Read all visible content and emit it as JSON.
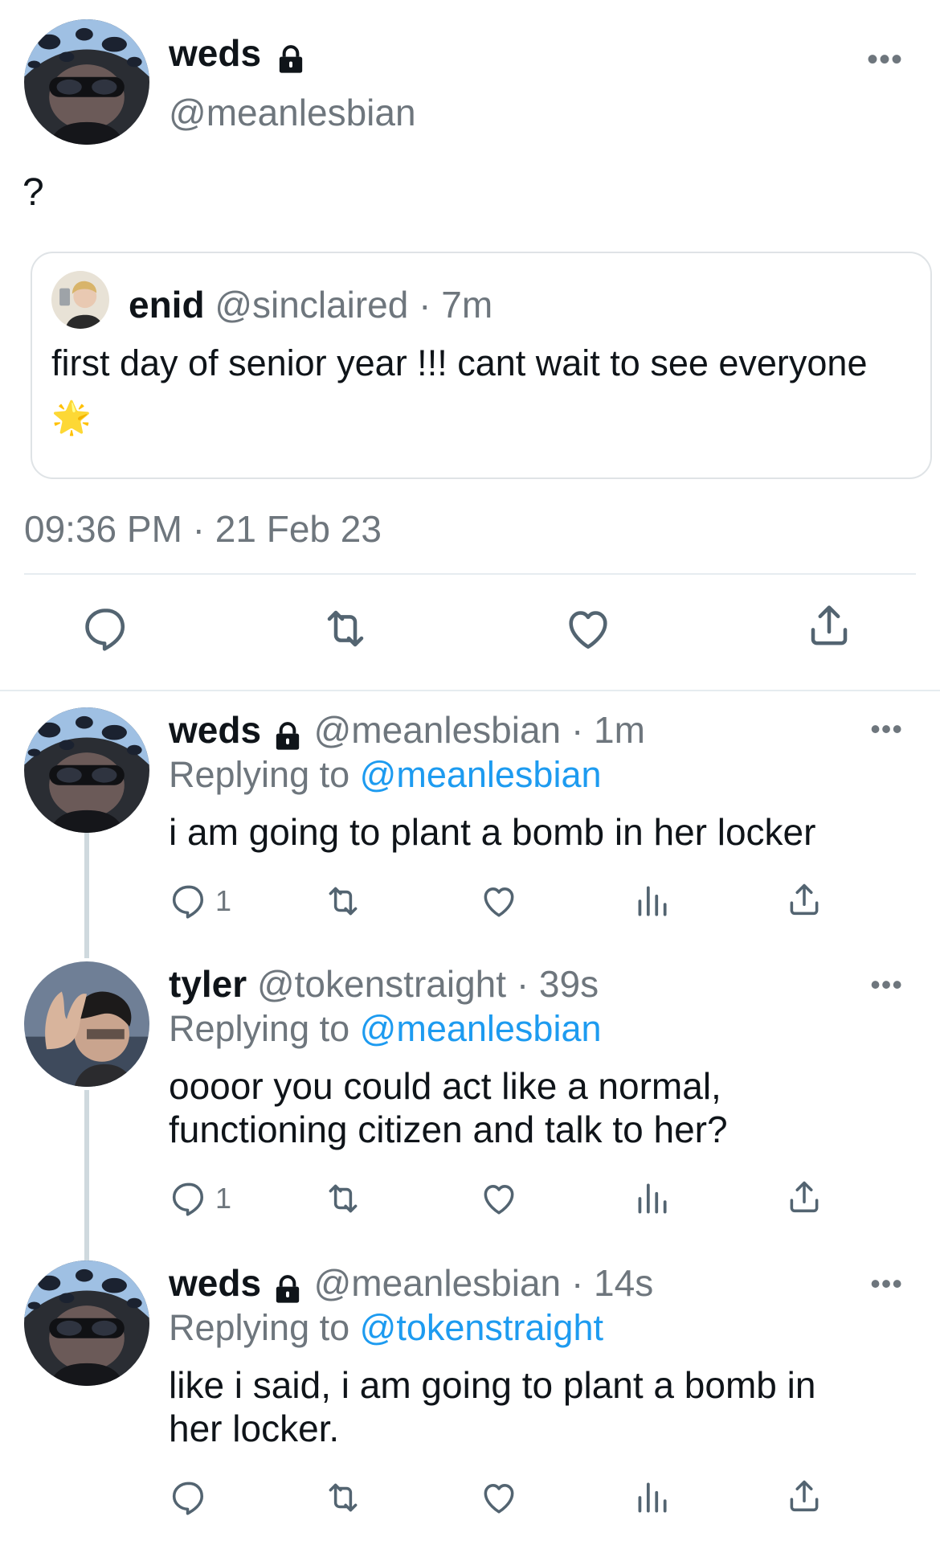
{
  "main_tweet": {
    "name": "weds",
    "handle": "@meanlesbian",
    "text": "?",
    "more_icon": "more-horizontal-icon",
    "quote": {
      "name": "enid",
      "handle": "@sinclaired",
      "time": "· 7m",
      "text": "first day of senior year !!! cant wait to see everyone",
      "emoji": "🌟"
    },
    "timestamp": "09:36 PM · 21 Feb 23",
    "actions": [
      "reply-icon",
      "retweet-icon",
      "like-icon",
      "share-icon"
    ]
  },
  "replies": [
    {
      "name": "weds",
      "handle": "@meanlesbian",
      "time": "· 1m",
      "replying_label": "Replying to",
      "replying_to": "@meanlesbian",
      "text": "i am going to plant a bomb in her locker",
      "reply_count": "1"
    },
    {
      "name": "tyler",
      "handle": "@tokenstraight",
      "time": "· 39s",
      "replying_label": "Replying to",
      "replying_to": "@meanlesbian",
      "text": "oooor you could act like a normal, functioning citizen and talk to her?",
      "reply_count": "1"
    },
    {
      "name": "weds",
      "handle": "@meanlesbian",
      "time": "· 14s",
      "replying_label": "Replying to",
      "replying_to": "@tokenstraight",
      "text": "like i said, i am going to plant a bomb in her locker.",
      "reply_count": ""
    }
  ],
  "colors": {
    "text": "#0f1419",
    "muted": "#6e767d",
    "link": "#1d9bf0",
    "border": "#dfe3e6"
  }
}
